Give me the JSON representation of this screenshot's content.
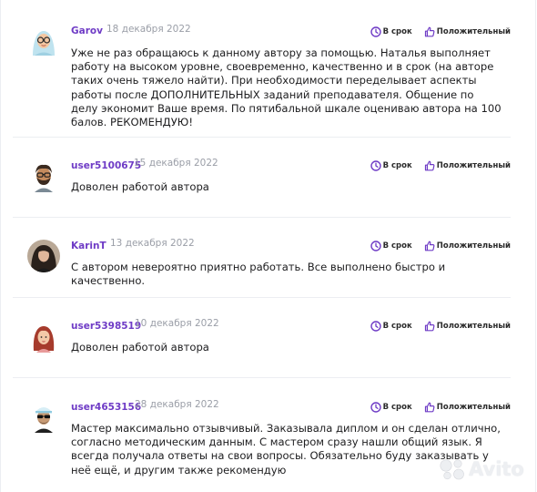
{
  "reviews": [
    {
      "name": "Garov",
      "date": "18 декабря 2022",
      "badge_time": "В срок",
      "badge_rating": "Положительный",
      "avatar": "woman-hijab-glasses-avatar",
      "text": "Уже не раз обращаюсь к данному автору за помощью. Наталья выполняет работу на высоком уровне, своевременно, качественно и в срок (на авторе таких очень тяжело найти). При необходимости переделывает аспекты работы после ДОПОЛНИТЕЛЬНЫХ заданий преподавателя. Общение по делу экономит Ваше время. По пятибальной шкале оцениваю автора на 100 балов. РЕКОМЕНДУЮ!"
    },
    {
      "name": "user5100675",
      "date": "15 декабря 2022",
      "badge_time": "В срок",
      "badge_rating": "Положительный",
      "avatar": "man-glasses-beard-avatar",
      "text": "Доволен работой автора"
    },
    {
      "name": "KarinT",
      "date": "13 декабря 2022",
      "badge_time": "В срок",
      "badge_rating": "Положительный",
      "avatar": "photo-avatar",
      "text": "С автором невероятно приятно работать. Все выполнено быстро и качественно."
    },
    {
      "name": "user5398519",
      "date": "10 декабря 2022",
      "badge_time": "В срок",
      "badge_rating": "Положительный",
      "avatar": "woman-red-hair-avatar",
      "text": "Доволен работой автора"
    },
    {
      "name": "user4653156",
      "date": "28 декабря 2022",
      "badge_time": "В срок",
      "badge_rating": "Положительный",
      "avatar": "man-sunglasses-cap-avatar",
      "text": "Мастер максимально отзывчивый. Заказывала диплом и он сделан отлично, согласно методическим данным. С мастером сразу нашли общий язык. Я всегда получала ответы на свои вопросы. Обязательно буду заказывать у неё ещё, и другим также рекомендую"
    }
  ],
  "icons": {
    "time": "clock-icon",
    "rating": "thumbs-up-icon"
  },
  "colors": {
    "accent": "#6f3cc6",
    "date": "#9a9ea7",
    "text": "#1d1d1f"
  },
  "watermark": {
    "text": "Avito",
    "icon": "avito-logo-icon"
  }
}
